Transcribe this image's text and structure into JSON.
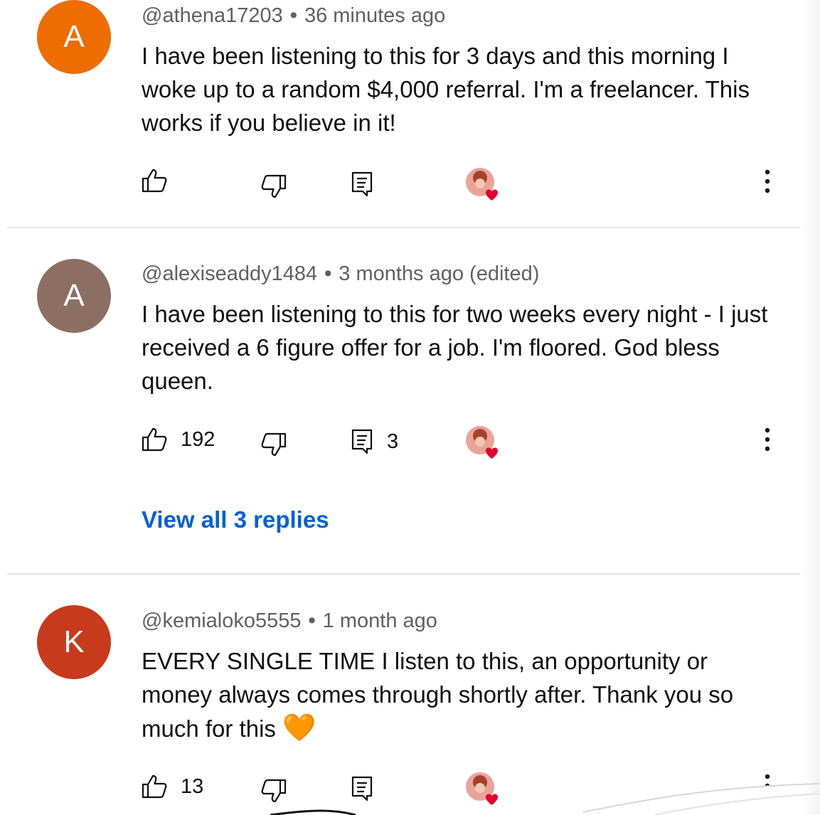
{
  "comments": [
    {
      "avatar_letter": "A",
      "avatar_color": "#ef6c00",
      "username": "@athena17203",
      "time": "36 minutes ago",
      "text": "I have been listening to this for 3 days and this morning I woke up to a random $4,000 referral. I'm a freelancer. This works if you believe in it!",
      "likes": "",
      "replies_count": ""
    },
    {
      "avatar_letter": "A",
      "avatar_color": "#8d6e63",
      "username": "@alexiseaddy1484",
      "time": "3 months ago (edited)",
      "text": "I have been listening to this for two weeks every night - I just received a 6 figure offer for a job. I'm floored. God bless queen.",
      "likes": "192",
      "replies_count": "3",
      "view_replies": "View all 3 replies"
    },
    {
      "avatar_letter": "K",
      "avatar_color": "#c73a1c",
      "username": "@kemialoko5555",
      "time": "1 month ago",
      "text": "EVERY SINGLE TIME I listen to this, an opportunity or money always comes through shortly after. Thank you so much for this",
      "emoji": "🧡",
      "likes": "13",
      "replies_count": ""
    }
  ],
  "meta_separator": "•",
  "icons": {
    "like": "thumbs-up-icon",
    "dislike": "thumbs-down-icon",
    "reply": "reply-comment-icon",
    "creator_heart": "creator-heart-avatar-icon",
    "more": "more-vertical-icon"
  },
  "colors": {
    "link": "#065fd4",
    "meta": "#606060",
    "text": "#0f0f0f",
    "heart": "#e4002b"
  }
}
